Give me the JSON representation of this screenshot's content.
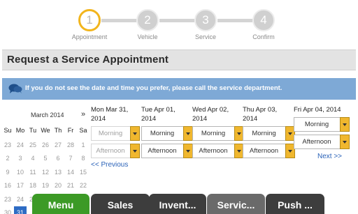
{
  "stepper": {
    "steps": [
      {
        "number": "1",
        "label": "Appointment"
      },
      {
        "number": "2",
        "label": "Vehicle"
      },
      {
        "number": "3",
        "label": "Service"
      },
      {
        "number": "4",
        "label": "Confirm"
      }
    ],
    "active_step": "1"
  },
  "page_title": "Request a Service Appointment",
  "info_banner": {
    "icon": "chat-bubbles-icon",
    "text": "If you do not see the date and time you prefer, please call the service department."
  },
  "calendar": {
    "month": "March 2014",
    "next": "»",
    "weekdays": [
      "Su",
      "Mo",
      "Tu",
      "We",
      "Th",
      "Fr",
      "Sa"
    ],
    "weeks": [
      [
        "23",
        "24",
        "25",
        "26",
        "27",
        "28",
        "1"
      ],
      [
        "2",
        "3",
        "4",
        "5",
        "6",
        "7",
        "8"
      ],
      [
        "9",
        "10",
        "11",
        "12",
        "13",
        "14",
        "15"
      ],
      [
        "16",
        "17",
        "18",
        "19",
        "20",
        "21",
        "22"
      ],
      [
        "23",
        "24",
        "25",
        "26",
        "27",
        "28",
        "29"
      ],
      [
        "30",
        "31",
        "",
        "",
        "",
        "",
        ""
      ]
    ],
    "selected": "31"
  },
  "days": [
    {
      "line1": "Mon Mar 31,",
      "line2": "2014",
      "morning": "Morning",
      "afternoon": "Afternoon",
      "enabled": false
    },
    {
      "line1": "Tue Apr 01,",
      "line2": "2014",
      "morning": "Morning",
      "afternoon": "Afternoon",
      "enabled": true
    },
    {
      "line1": "Wed Apr 02,",
      "line2": "2014",
      "morning": "Morning",
      "afternoon": "Afternoon",
      "enabled": true
    },
    {
      "line1": "Thu Apr 03,",
      "line2": "2014",
      "morning": "Morning",
      "afternoon": "Afternoon",
      "enabled": true
    },
    {
      "line1": "Fri Apr 04, 2014",
      "line2": "",
      "morning": "Morning",
      "afternoon": "Afternoon",
      "enabled": true
    }
  ],
  "previous_link": "<< Previous",
  "next_link": "Next >>",
  "bottom_nav": [
    {
      "label": "Menu",
      "color": "#3c9a26"
    },
    {
      "label": "Sales",
      "color": "#3d3d3d"
    },
    {
      "label": "Invent...",
      "color": "#3d3d3d"
    },
    {
      "label": "Servic...",
      "color": "#6a6a6a"
    },
    {
      "label": "Push ...",
      "color": "#3d3d3d"
    }
  ],
  "colors": {
    "accent": "#f2b51d",
    "banner": "#7ea9d6",
    "link": "#2a62b8",
    "calendar_selected": "#2e6cc4"
  }
}
